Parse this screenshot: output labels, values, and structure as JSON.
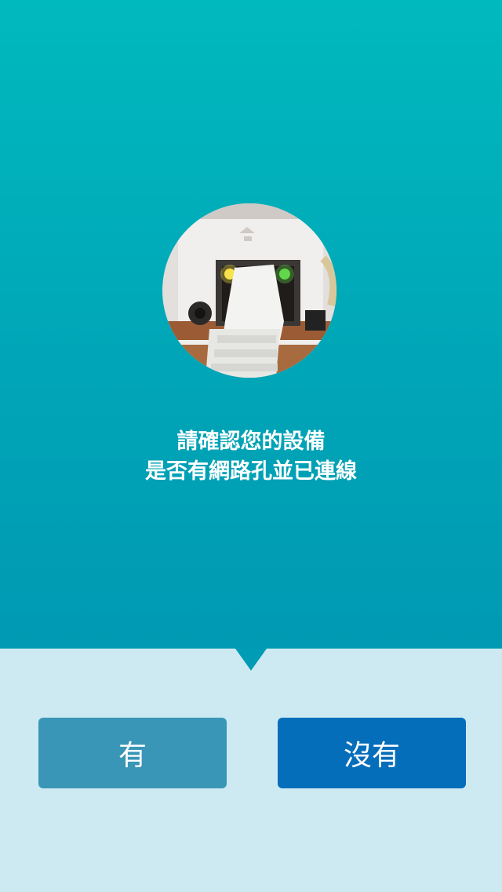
{
  "prompt": {
    "line1": "請確認您的設備",
    "line2": "是否有網路孔並已連線"
  },
  "buttons": {
    "yes_label": "有",
    "no_label": "沒有"
  },
  "colors": {
    "top_gradient_start": "#00b9be",
    "top_gradient_end": "#0099b3",
    "bottom_background": "#cdeaf2",
    "yes_button": "#3a96b6",
    "no_button": "#056ebb"
  }
}
